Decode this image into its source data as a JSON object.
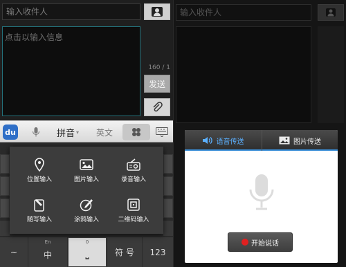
{
  "left": {
    "recipient_placeholder": "输入收件人",
    "message_placeholder": "点击以输入信息",
    "counter": "160 / 1",
    "send_label": "发送"
  },
  "ime": {
    "logo": "du",
    "pinyin_label": "拼音",
    "english_label": "英文"
  },
  "popup": {
    "items": [
      {
        "label": "位置输入",
        "icon": "location-icon"
      },
      {
        "label": "图片输入",
        "icon": "image-icon"
      },
      {
        "label": "录音输入",
        "icon": "recorder-icon"
      },
      {
        "label": "随写输入",
        "icon": "handwrite-icon"
      },
      {
        "label": "涂鸦输入",
        "icon": "doodle-icon"
      },
      {
        "label": "二维码输入",
        "icon": "qrcode-icon"
      }
    ]
  },
  "keys": {
    "tilde": "~",
    "en_small": "En",
    "zhong": "中",
    "zero_small": "0",
    "symbol": "符 号",
    "num": "123"
  },
  "right": {
    "recipient_placeholder": "输入收件人",
    "tab_voice": "语音传送",
    "tab_image": "图片传送",
    "start_label": "开始说话",
    "accent_color": "#3a8fd8",
    "record_color": "#e02020"
  }
}
